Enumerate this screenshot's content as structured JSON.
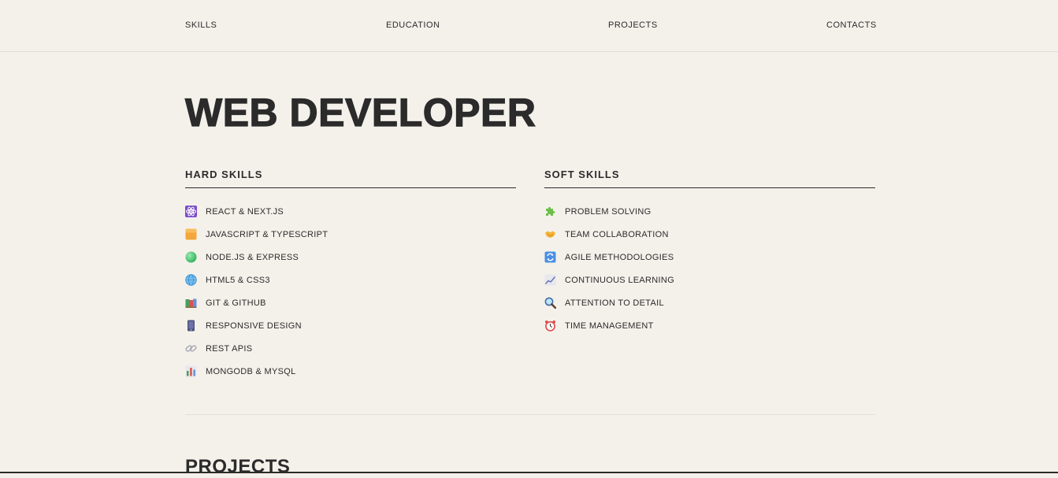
{
  "nav": {
    "skills": "SKILLS",
    "education": "EDUCATION",
    "projects": "PROJECTS",
    "contacts": "CONTACTS"
  },
  "hero": {
    "title": "WEB DEVELOPER"
  },
  "hard_skills": {
    "heading": "HARD SKILLS",
    "items": [
      {
        "label": "REACT & NEXT.JS",
        "icon": "atom-icon"
      },
      {
        "label": "JAVASCRIPT & TYPESCRIPT",
        "icon": "yellow-square-icon"
      },
      {
        "label": "NODE.JS & EXPRESS",
        "icon": "green-circle-icon"
      },
      {
        "label": "HTML5 & CSS3",
        "icon": "globe-icon"
      },
      {
        "label": "GIT & GITHUB",
        "icon": "books-icon"
      },
      {
        "label": "RESPONSIVE DESIGN",
        "icon": "mobile-phone-icon"
      },
      {
        "label": "REST APIS",
        "icon": "link-icon"
      },
      {
        "label": "MONGODB & MYSQL",
        "icon": "bar-chart-icon"
      }
    ]
  },
  "soft_skills": {
    "heading": "SOFT SKILLS",
    "items": [
      {
        "label": "PROBLEM SOLVING",
        "icon": "puzzle-icon"
      },
      {
        "label": "TEAM COLLABORATION",
        "icon": "handshake-icon"
      },
      {
        "label": "AGILE METHODOLOGIES",
        "icon": "cycle-icon"
      },
      {
        "label": "CONTINUOUS LEARNING",
        "icon": "trend-chart-icon"
      },
      {
        "label": "ATTENTION TO DETAIL",
        "icon": "magnifier-icon"
      },
      {
        "label": "TIME MANAGEMENT",
        "icon": "alarm-clock-icon"
      }
    ]
  },
  "projects": {
    "title": "PROJECTS"
  },
  "colors": {
    "background": "#f4f1eb",
    "text": "#2b2b2b",
    "divider": "#e2ded7"
  }
}
